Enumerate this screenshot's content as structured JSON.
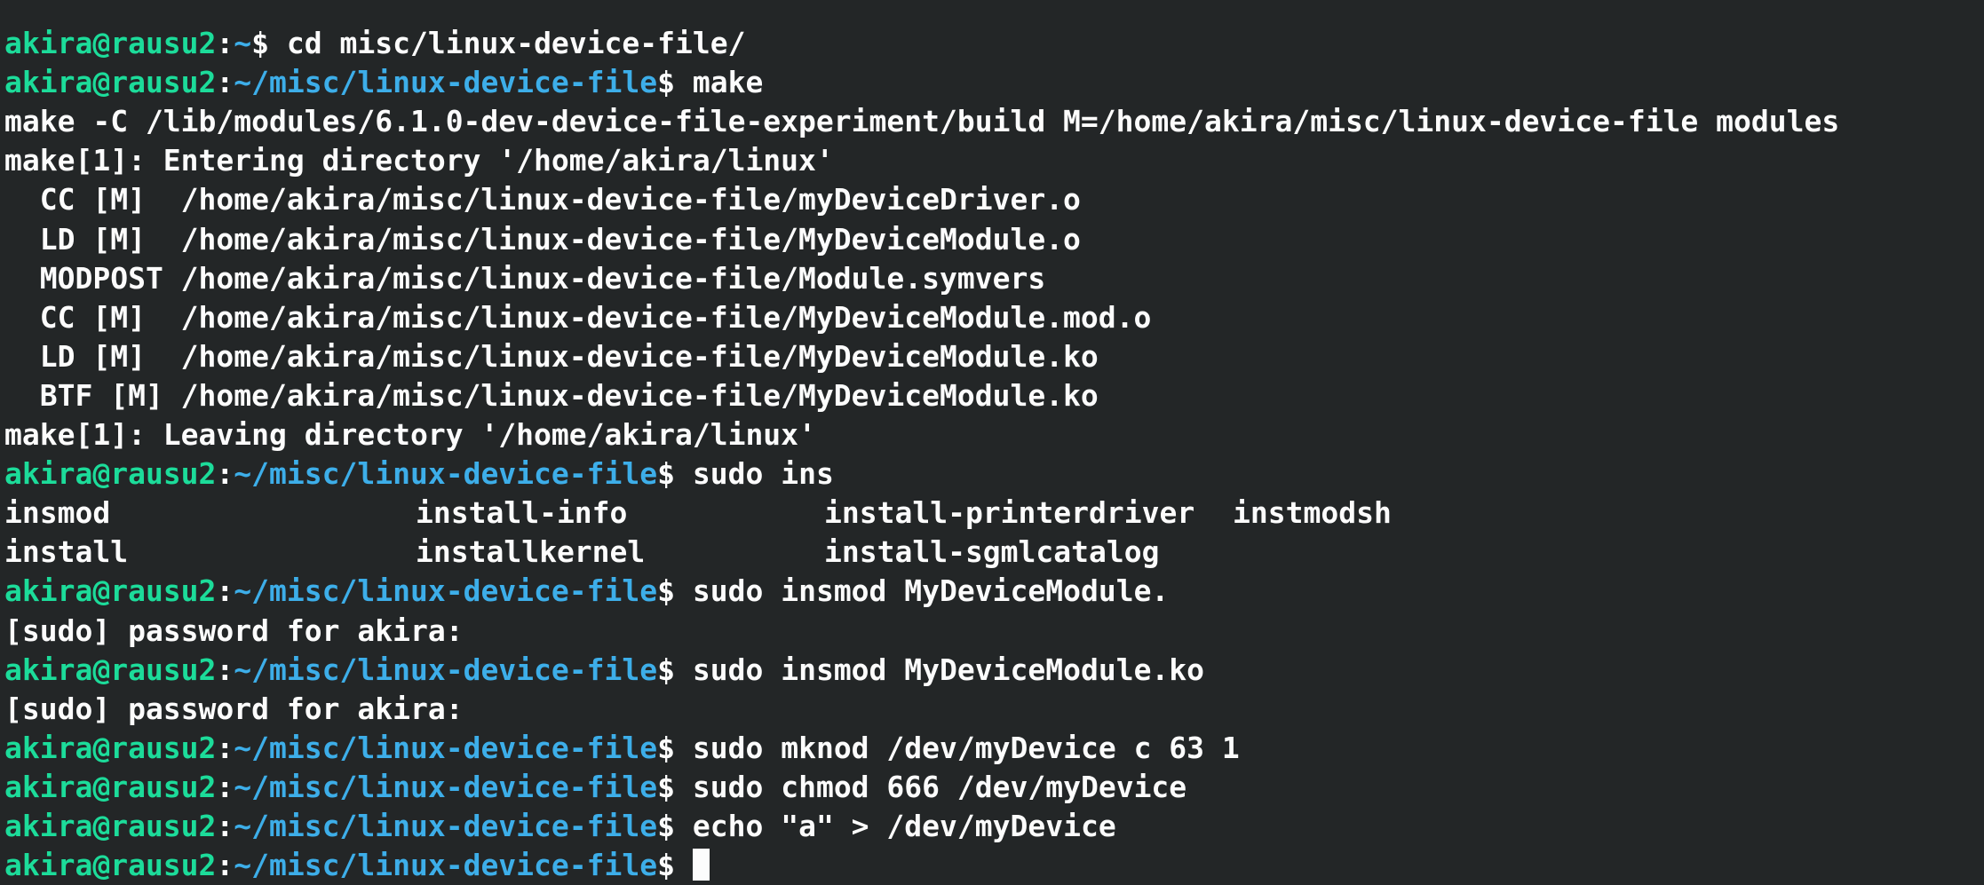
{
  "prompt": {
    "user_host": "akira@rausu2",
    "sep": ":",
    "home_dir": "~",
    "dir": "~/misc/linux-device-file",
    "dollar": "$ "
  },
  "lines": [
    {
      "type": "output",
      "text": ""
    },
    {
      "type": "prompt",
      "dir": "~",
      "cmd": "cd misc/linux-device-file/"
    },
    {
      "type": "prompt",
      "dir": "~/misc/linux-device-file",
      "cmd": "make"
    },
    {
      "type": "output",
      "text": "make -C /lib/modules/6.1.0-dev-device-file-experiment/build M=/home/akira/misc/linux-device-file modules"
    },
    {
      "type": "output",
      "text": "make[1]: Entering directory '/home/akira/linux'"
    },
    {
      "type": "output",
      "text": "  CC [M]  /home/akira/misc/linux-device-file/myDeviceDriver.o"
    },
    {
      "type": "output",
      "text": "  LD [M]  /home/akira/misc/linux-device-file/MyDeviceModule.o"
    },
    {
      "type": "output",
      "text": "  MODPOST /home/akira/misc/linux-device-file/Module.symvers"
    },
    {
      "type": "output",
      "text": "  CC [M]  /home/akira/misc/linux-device-file/MyDeviceModule.mod.o"
    },
    {
      "type": "output",
      "text": "  LD [M]  /home/akira/misc/linux-device-file/MyDeviceModule.ko"
    },
    {
      "type": "output",
      "text": "  BTF [M] /home/akira/misc/linux-device-file/MyDeviceModule.ko"
    },
    {
      "type": "output",
      "text": "make[1]: Leaving directory '/home/akira/linux'"
    },
    {
      "type": "prompt",
      "dir": "~/misc/linux-device-file",
      "cmd": "sudo ins"
    },
    {
      "type": "columns",
      "cols": [
        "insmod",
        "install-info",
        "install-printerdriver",
        "instmodsh"
      ]
    },
    {
      "type": "columns",
      "cols": [
        "install",
        "installkernel",
        "install-sgmlcatalog",
        ""
      ]
    },
    {
      "type": "prompt",
      "dir": "~/misc/linux-device-file",
      "cmd": "sudo insmod MyDeviceModule."
    },
    {
      "type": "output",
      "text": "[sudo] password for akira:"
    },
    {
      "type": "prompt",
      "dir": "~/misc/linux-device-file",
      "cmd": "sudo insmod MyDeviceModule.ko"
    },
    {
      "type": "output",
      "text": "[sudo] password for akira:"
    },
    {
      "type": "prompt",
      "dir": "~/misc/linux-device-file",
      "cmd": "sudo mknod /dev/myDevice c 63 1"
    },
    {
      "type": "prompt",
      "dir": "~/misc/linux-device-file",
      "cmd": "sudo chmod 666 /dev/myDevice"
    },
    {
      "type": "prompt",
      "dir": "~/misc/linux-device-file",
      "cmd": "echo \"a\" > /dev/myDevice"
    },
    {
      "type": "prompt",
      "dir": "~/misc/linux-device-file",
      "cmd": "",
      "cursor": true
    }
  ],
  "colors": {
    "background": "#232627",
    "text": "#fcfcfc",
    "user_host": "#1cdc9a",
    "path": "#3daee9"
  }
}
